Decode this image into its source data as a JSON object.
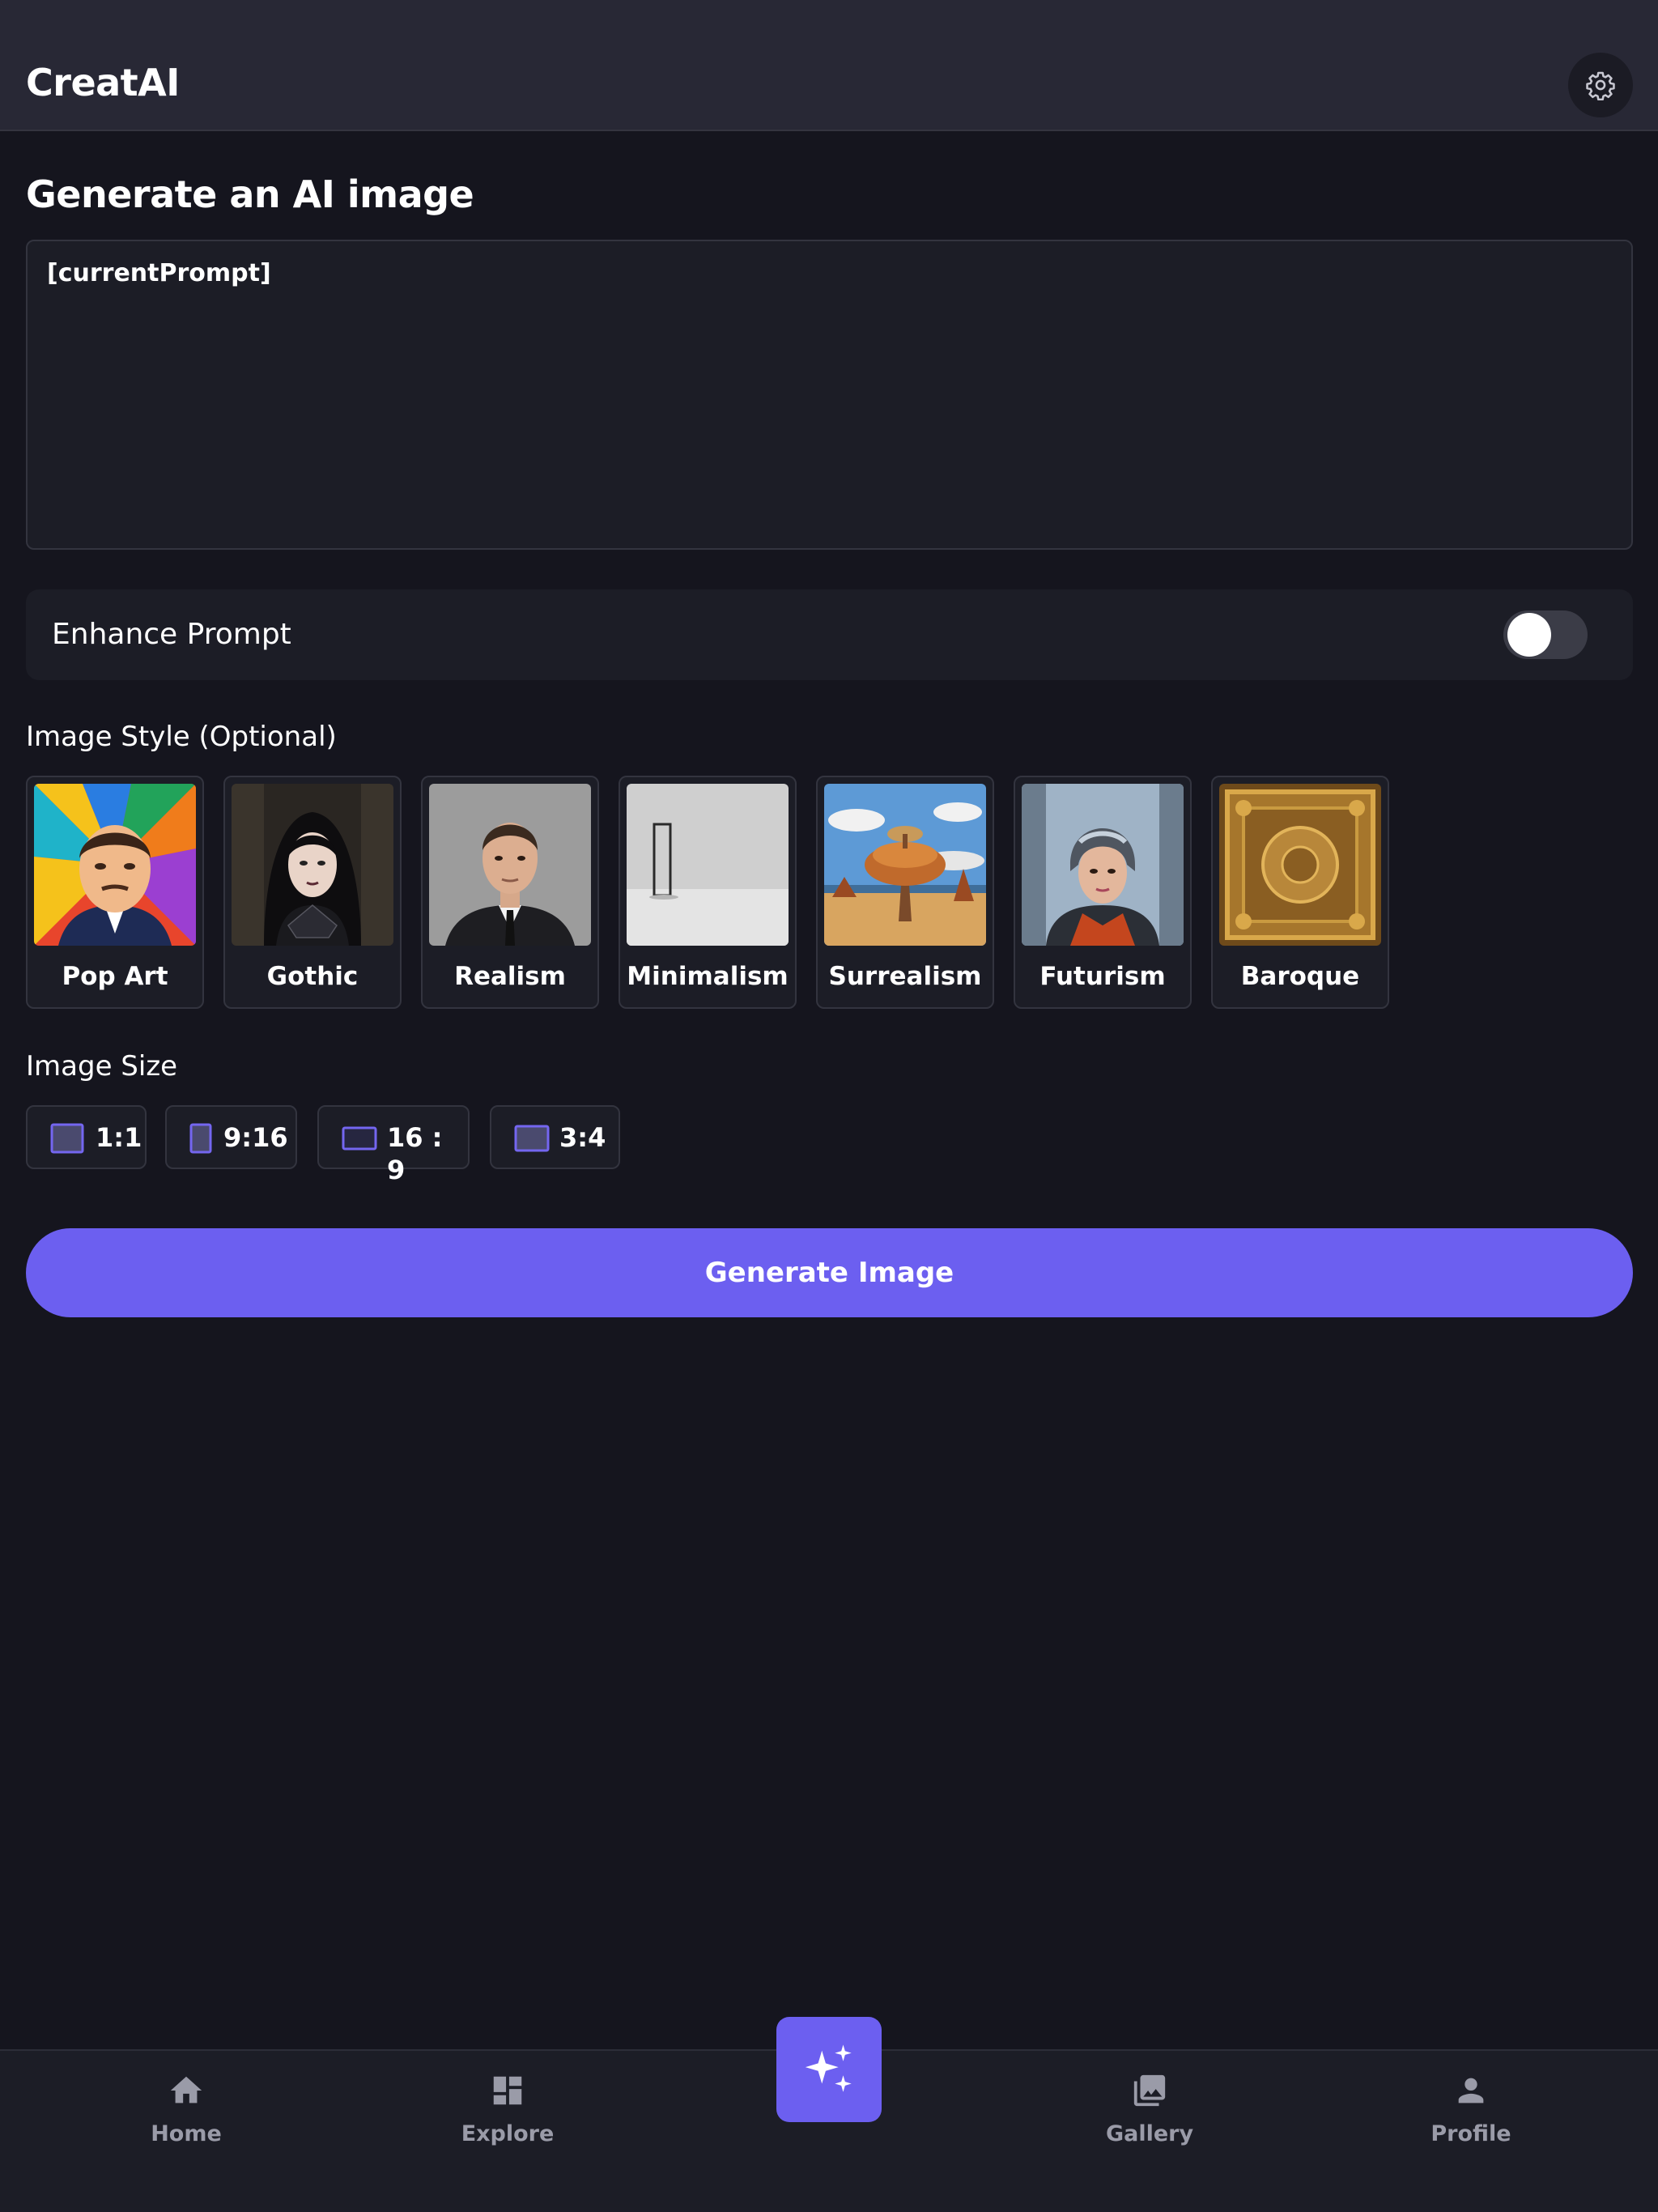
{
  "header": {
    "app_title": "CreatAI",
    "settings_icon": "gear-icon"
  },
  "main": {
    "page_title": "Generate an AI image",
    "prompt": {
      "value": "[currentPrompt]",
      "placeholder": ""
    },
    "enhance": {
      "label": "Enhance Prompt",
      "enabled": false
    },
    "style_section": {
      "label": "Image Style (Optional)",
      "styles": [
        {
          "name": "Pop Art"
        },
        {
          "name": "Gothic"
        },
        {
          "name": "Realism"
        },
        {
          "name": "Minimalism"
        },
        {
          "name": "Surrealism"
        },
        {
          "name": "Futurism"
        },
        {
          "name": "Baroque"
        }
      ]
    },
    "size_section": {
      "label": "Image Size",
      "sizes": [
        {
          "label": "1:1",
          "icon": "square-ratio-icon"
        },
        {
          "label": "9:16",
          "icon": "portrait-ratio-icon"
        },
        {
          "label": "16 : 9",
          "icon": "landscape-ratio-icon"
        },
        {
          "label": "3:4",
          "icon": "ratio-icon"
        }
      ]
    },
    "generate_label": "Generate Image"
  },
  "bottom_nav": {
    "items": [
      {
        "label": "Home",
        "icon": "home-icon"
      },
      {
        "label": "Explore",
        "icon": "dashboard-icon"
      },
      {
        "label": "Gallery",
        "icon": "gallery-icon"
      },
      {
        "label": "Profile",
        "icon": "person-icon"
      }
    ],
    "fab_icon": "sparkles-icon"
  },
  "colors": {
    "background": "#15151e",
    "header": "#282835",
    "surface": "#1c1d26",
    "accent": "#6c5ff0",
    "muted_text": "#9a9ba8"
  }
}
